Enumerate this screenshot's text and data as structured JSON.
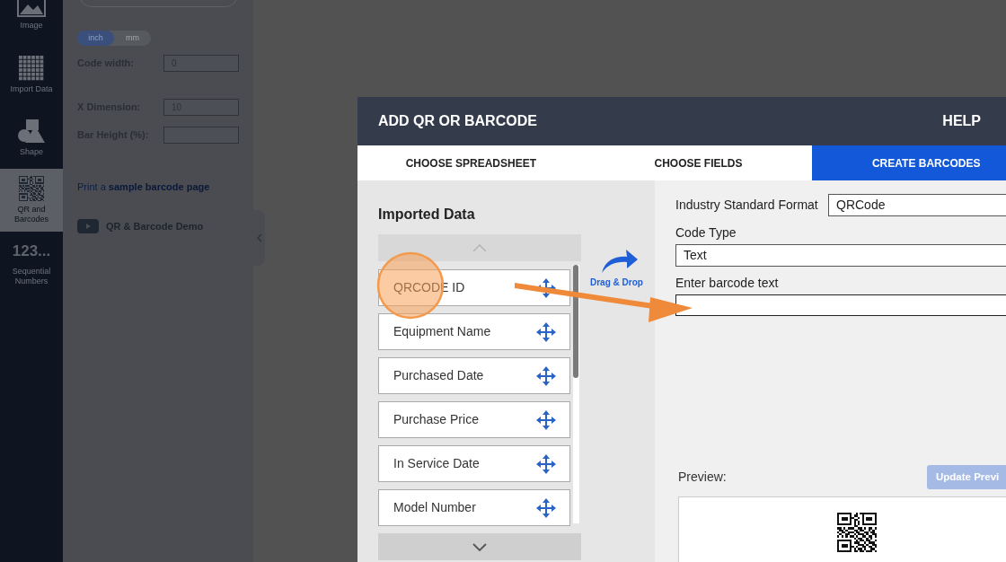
{
  "sidebar": {
    "items": [
      {
        "label": "Image",
        "selected": false
      },
      {
        "label": "Import Data",
        "selected": false
      },
      {
        "label": "Shape",
        "selected": false
      },
      {
        "label": "QR and Barcodes",
        "selected": true
      },
      {
        "label": "Sequential Numbers",
        "icon_text": "123...",
        "selected": false
      }
    ]
  },
  "settings_panel": {
    "units": [
      {
        "label": "inch",
        "selected": true
      },
      {
        "label": "mm",
        "selected": false
      }
    ],
    "fields": [
      {
        "label": "Code width:",
        "value": "0"
      },
      {
        "label": "X Dimension:",
        "value": "10"
      },
      {
        "label": "Bar Height (%):"
      }
    ],
    "sample_link": {
      "prefix": "Print a ",
      "link": "sample barcode page"
    },
    "demo": "QR & Barcode Demo"
  },
  "dialog": {
    "title": "ADD QR OR BARCODE",
    "help": "HELP",
    "tabs": [
      {
        "label": "CHOOSE SPREADSHEET",
        "selected": false
      },
      {
        "label": "CHOOSE FIELDS",
        "selected": false
      },
      {
        "label": "CREATE BARCODES",
        "selected": true
      }
    ],
    "imported_data": {
      "title": "Imported Data",
      "items": [
        "QRCODE ID",
        "Equipment Name",
        "Purchased Date",
        "Purchase Price",
        "In Service Date",
        "Model Number"
      ]
    },
    "drag_hint": "Drag & Drop",
    "form": {
      "format_label": "Industry Standard Format",
      "format_value": "QRCode",
      "code_type_label": "Code Type",
      "code_type_value": "Text",
      "text_label": "Enter barcode text"
    },
    "preview": {
      "label": "Preview:",
      "button": "Update Previ"
    }
  }
}
